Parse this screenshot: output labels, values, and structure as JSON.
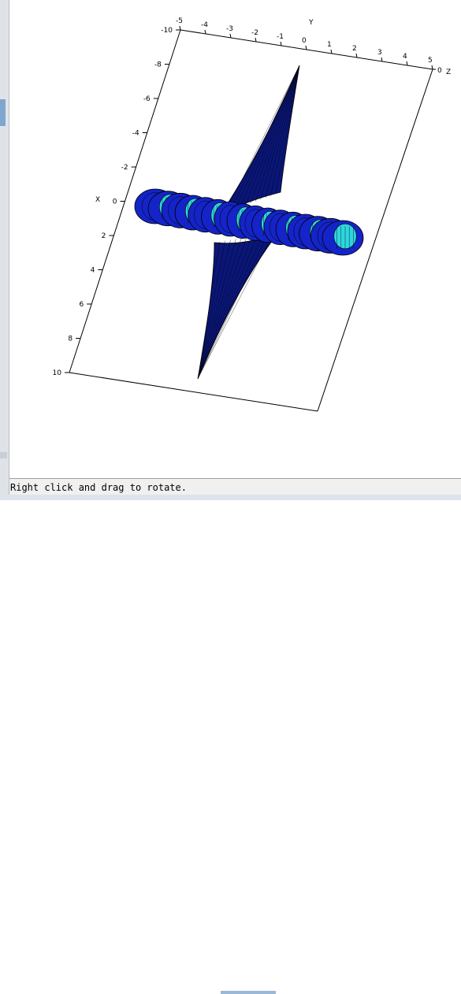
{
  "plot": {
    "y_axis": {
      "name": "Y",
      "ticks": [
        "-5",
        "-4",
        "-3",
        "-2",
        "-1",
        "0",
        "1",
        "2",
        "3",
        "4",
        "5"
      ]
    },
    "x_axis": {
      "name": "X",
      "ticks": [
        "-10",
        "-8",
        "-6",
        "-4",
        "-2",
        "0",
        "2",
        "4",
        "6",
        "8",
        "10"
      ]
    },
    "z_axis": {
      "name": "Z",
      "ticks": [
        "0"
      ]
    },
    "colors": {
      "spine": "#0a1678",
      "mesh_line": "#000000",
      "torus_dark": "#1424c8",
      "torus_light": "#2ed6df",
      "box": "#000000"
    }
  },
  "status": {
    "message": "Right click and drag to rotate."
  }
}
